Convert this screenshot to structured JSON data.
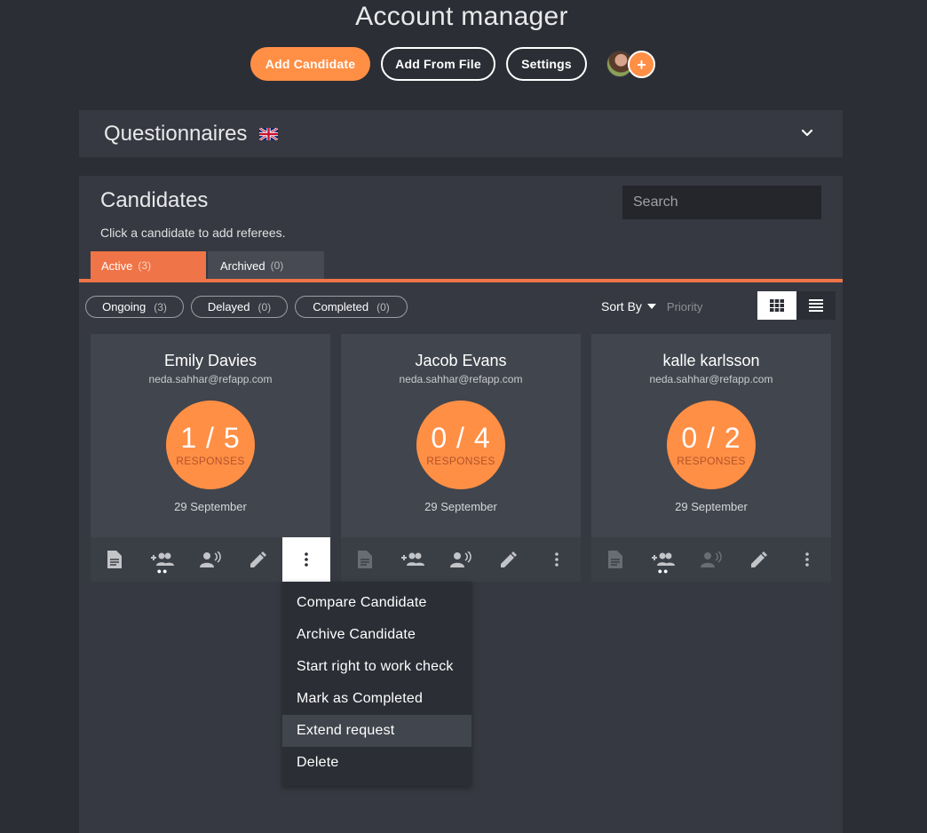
{
  "header": {
    "title": "Account manager",
    "add_candidate": "Add Candidate",
    "add_from_file": "Add From File",
    "settings": "Settings",
    "add_avatar_symbol": "+"
  },
  "questionnaires": {
    "title": "Questionnaires",
    "flag_icon": "uk-flag-icon",
    "expand_icon": "chevron-down-icon"
  },
  "candidates": {
    "title": "Candidates",
    "hint": "Click a candidate to add referees.",
    "search_placeholder": "Search",
    "tabs": [
      {
        "label": "Active",
        "count": "(3)",
        "active": true
      },
      {
        "label": "Archived",
        "count": "(0)",
        "active": false
      }
    ],
    "filters": [
      {
        "label": "Ongoing",
        "count": "(3)"
      },
      {
        "label": "Delayed",
        "count": "(0)"
      },
      {
        "label": "Completed",
        "count": "(0)"
      }
    ],
    "sort_label": "Sort By",
    "sort_value": "Priority",
    "view_mode": "grid",
    "cards": [
      {
        "name": "Emily Davies",
        "email": "neda.sahhar@refapp.com",
        "responses": "1 / 5",
        "responses_label": "RESPONSES",
        "date": "29 September"
      },
      {
        "name": "Jacob Evans",
        "email": "neda.sahhar@refapp.com",
        "responses": "0 / 4",
        "responses_label": "RESPONSES",
        "date": "29 September"
      },
      {
        "name": "kalle karlsson",
        "email": "neda.sahhar@refapp.com",
        "responses": "0 / 2",
        "responses_label": "RESPONSES",
        "date": "29 September"
      }
    ],
    "card_action_icons": [
      "document-icon",
      "add-referee-icon",
      "voice-call-icon",
      "edit-icon",
      "more-vert-icon"
    ]
  },
  "context_menu": {
    "items": [
      "Compare Candidate",
      "Archive Candidate",
      "Start right to work check",
      "Mark as Completed",
      "Extend request",
      "Delete"
    ],
    "highlighted": "Extend request"
  },
  "colors": {
    "accent": "#ff8f45",
    "tab_accent": "#ef7447",
    "background": "#2b2e35",
    "panel": "#363941",
    "card": "#41454d"
  }
}
